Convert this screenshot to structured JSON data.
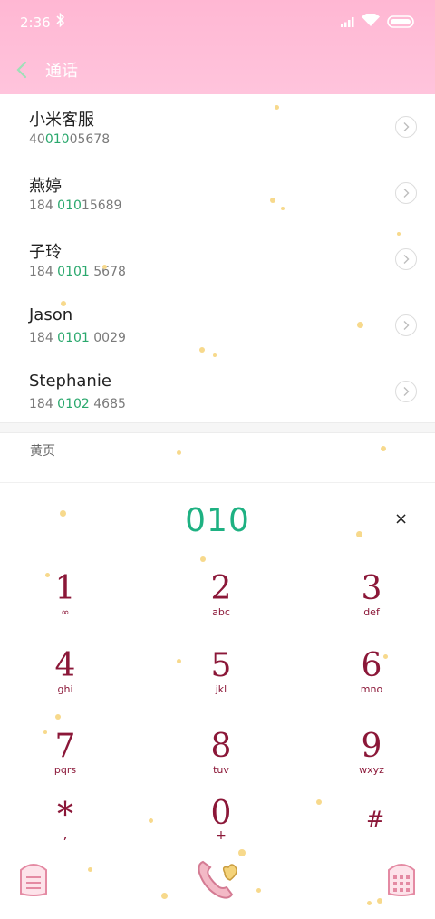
{
  "status_bar": {
    "time": "2:36"
  },
  "app_bar": {
    "title": "通话"
  },
  "contacts": [
    {
      "name": "小米客服",
      "num_pre": "40",
      "num_hl": "010",
      "num_post": "05678"
    },
    {
      "name": "燕婷",
      "num_pre": "184 ",
      "num_hl": "010",
      "num_post": "15689"
    },
    {
      "name": "子玲",
      "num_pre": "184 ",
      "num_hl": "0101",
      "num_post": " 5678"
    },
    {
      "name": "Jason",
      "num_pre": "184 ",
      "num_hl": "0101",
      "num_post": " 0029"
    },
    {
      "name": "Stephanie",
      "num_pre": "184 ",
      "num_hl": "0102",
      "num_post": " 4685"
    }
  ],
  "section": {
    "label": "黄页"
  },
  "dialer": {
    "input": "010",
    "clear": "×",
    "keys": [
      {
        "digit": "1",
        "letters": "∞"
      },
      {
        "digit": "2",
        "letters": "abc"
      },
      {
        "digit": "3",
        "letters": "def"
      },
      {
        "digit": "4",
        "letters": "ghi"
      },
      {
        "digit": "5",
        "letters": "jkl"
      },
      {
        "digit": "6",
        "letters": "mno"
      },
      {
        "digit": "7",
        "letters": "pqrs"
      },
      {
        "digit": "8",
        "letters": "tuv"
      },
      {
        "digit": "9",
        "letters": "wxyz"
      },
      {
        "digit": "*",
        "letters": ","
      },
      {
        "digit": "0",
        "letters": "+"
      },
      {
        "digit": "#",
        "letters": ""
      }
    ]
  },
  "colors": {
    "accent": "#1eb182",
    "key_text": "#8b1738",
    "top_bar": "#ffbcd7"
  }
}
